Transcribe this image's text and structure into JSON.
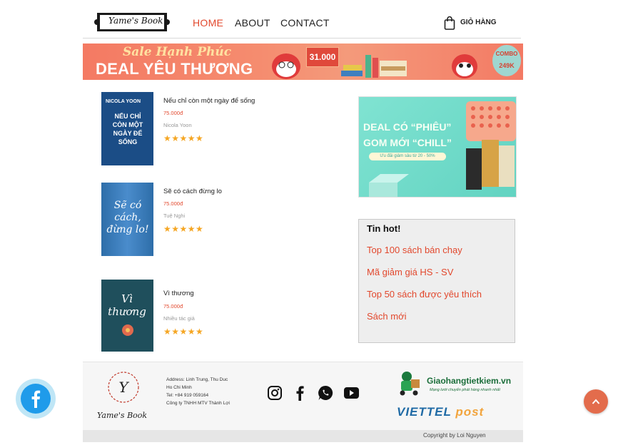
{
  "header": {
    "logo_text": "Yame's Book",
    "nav": [
      {
        "label": "HOME",
        "active": true
      },
      {
        "label": "ABOUT",
        "active": false
      },
      {
        "label": "CONTACT",
        "active": false
      }
    ],
    "cart_label": "GIỎ HÀNG",
    "cart_icon": "shopping-bag-icon"
  },
  "banner": {
    "line1": "Sale Hạnh Phúc",
    "line2": "DEAL YÊU THƯƠNG",
    "combo_price": "31.000",
    "combo2_line1": "COMBO",
    "combo2_line2": "249K"
  },
  "products": [
    {
      "title": "Nếu chỉ còn một ngày để sống",
      "price": "75.000đ",
      "author": "Nicola Yoon",
      "rating": 5,
      "cover_top": "NICOLA YOON",
      "cover_text": "NẾU CHỈ CÒN MỘT NGÀY ĐỂ SỐNG"
    },
    {
      "title": "Sẽ có cách đừng lo",
      "price": "75.000đ",
      "author": "Tuệ Nghi",
      "rating": 5,
      "cover_text": "Sẽ có cách, đừng lo!"
    },
    {
      "title": "Vì thương",
      "price": "75.000đ",
      "author": "Nhiều tác giả",
      "rating": 5,
      "cover_text": "Vì thương"
    }
  ],
  "ad": {
    "line1": "DEAL CÓ “PHIÊU”",
    "line2": "GOM MỚI “CHILL”",
    "pill": "Ưu đãi giảm sâu từ 20 - 50%"
  },
  "hot": {
    "title": "Tin hot!",
    "items": [
      "Top 100 sách bán chạy",
      "Mã giảm giá HS - SV",
      "Top 50 sách được yêu thích",
      "Sách mới"
    ]
  },
  "footer": {
    "logo_text": "Yame's Book",
    "address_lines": [
      "Address: Linh Trung, Thu Duc",
      "Ho Chi Minh",
      "Tel: +84 919 059164",
      "Công ty TNHH MTV Thành Lợi"
    ],
    "social": [
      "instagram-icon",
      "facebook-icon",
      "whatsapp-icon",
      "youtube-icon"
    ],
    "ghtk_name": "Giaohangtietkiem.vn",
    "ghtk_sub": "Mạng lưới chuyển phát hàng nhanh nhất",
    "viettel_a": "VIETTEL",
    "viettel_b": "post",
    "copyright": "Copyright by Loi Nguyen"
  },
  "colors": {
    "accent": "#e2482d",
    "star": "#f5a623",
    "facebook": "#1f9bea"
  }
}
